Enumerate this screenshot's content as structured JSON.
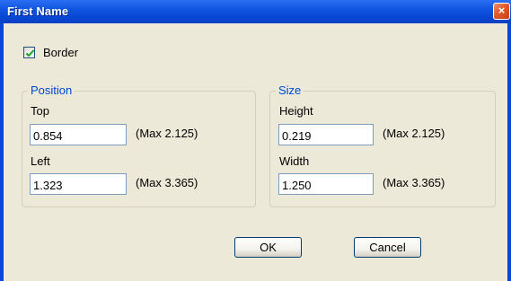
{
  "window": {
    "title": "First Name",
    "close_glyph": "×"
  },
  "border_checkbox": {
    "label": "Border",
    "checked": true
  },
  "position_group": {
    "title": "Position",
    "top_label": "Top",
    "top_value": "0.854",
    "top_max": "(Max 2.125)",
    "left_label": "Left",
    "left_value": "1.323",
    "left_max": "(Max 3.365)"
  },
  "size_group": {
    "title": "Size",
    "height_label": "Height",
    "height_value": "0.219",
    "height_max": "(Max 2.125)",
    "width_label": "Width",
    "width_value": "1.250",
    "width_max": "(Max 3.365)"
  },
  "buttons": {
    "ok": "OK",
    "cancel": "Cancel"
  },
  "colors": {
    "titlebar": "#0a47d6",
    "client_bg": "#ece9d8",
    "group_title": "#0046d5",
    "close_button": "#e25a2c"
  }
}
